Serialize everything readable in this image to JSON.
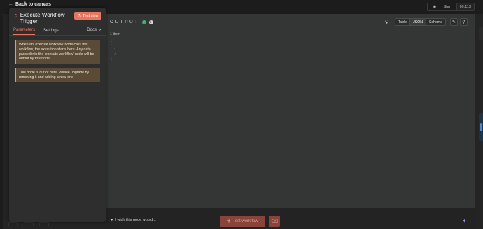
{
  "canvas": {
    "back_label": "Back to canvas",
    "github": {
      "star_label": "Star",
      "count": "69,113"
    }
  },
  "node": {
    "title": "Execute Workflow Trigger",
    "test_step_label": "Test step",
    "accent": "#e8755f"
  },
  "tabs": {
    "parameters": "Parameters",
    "settings": "Settings",
    "docs": "Docs"
  },
  "notices": {
    "trigger_info": "When an ‘execute workflow’ node calls this workflow, the execution starts here. Any data passed into the ‘execute workflow’ node will be output by this node.",
    "outdated": "This node is out of date. Please upgrade by removing it and adding a new one"
  },
  "output": {
    "title": "OUTPUT",
    "items_count": "1 item",
    "view_modes": [
      "Table",
      "JSON",
      "Schema"
    ],
    "selected_view": "JSON",
    "json_lines": [
      "[",
      "{",
      "}",
      "]"
    ]
  },
  "footer": {
    "feedback_label": "I wish this node would...",
    "test_workflow_label": "Test workflow"
  }
}
